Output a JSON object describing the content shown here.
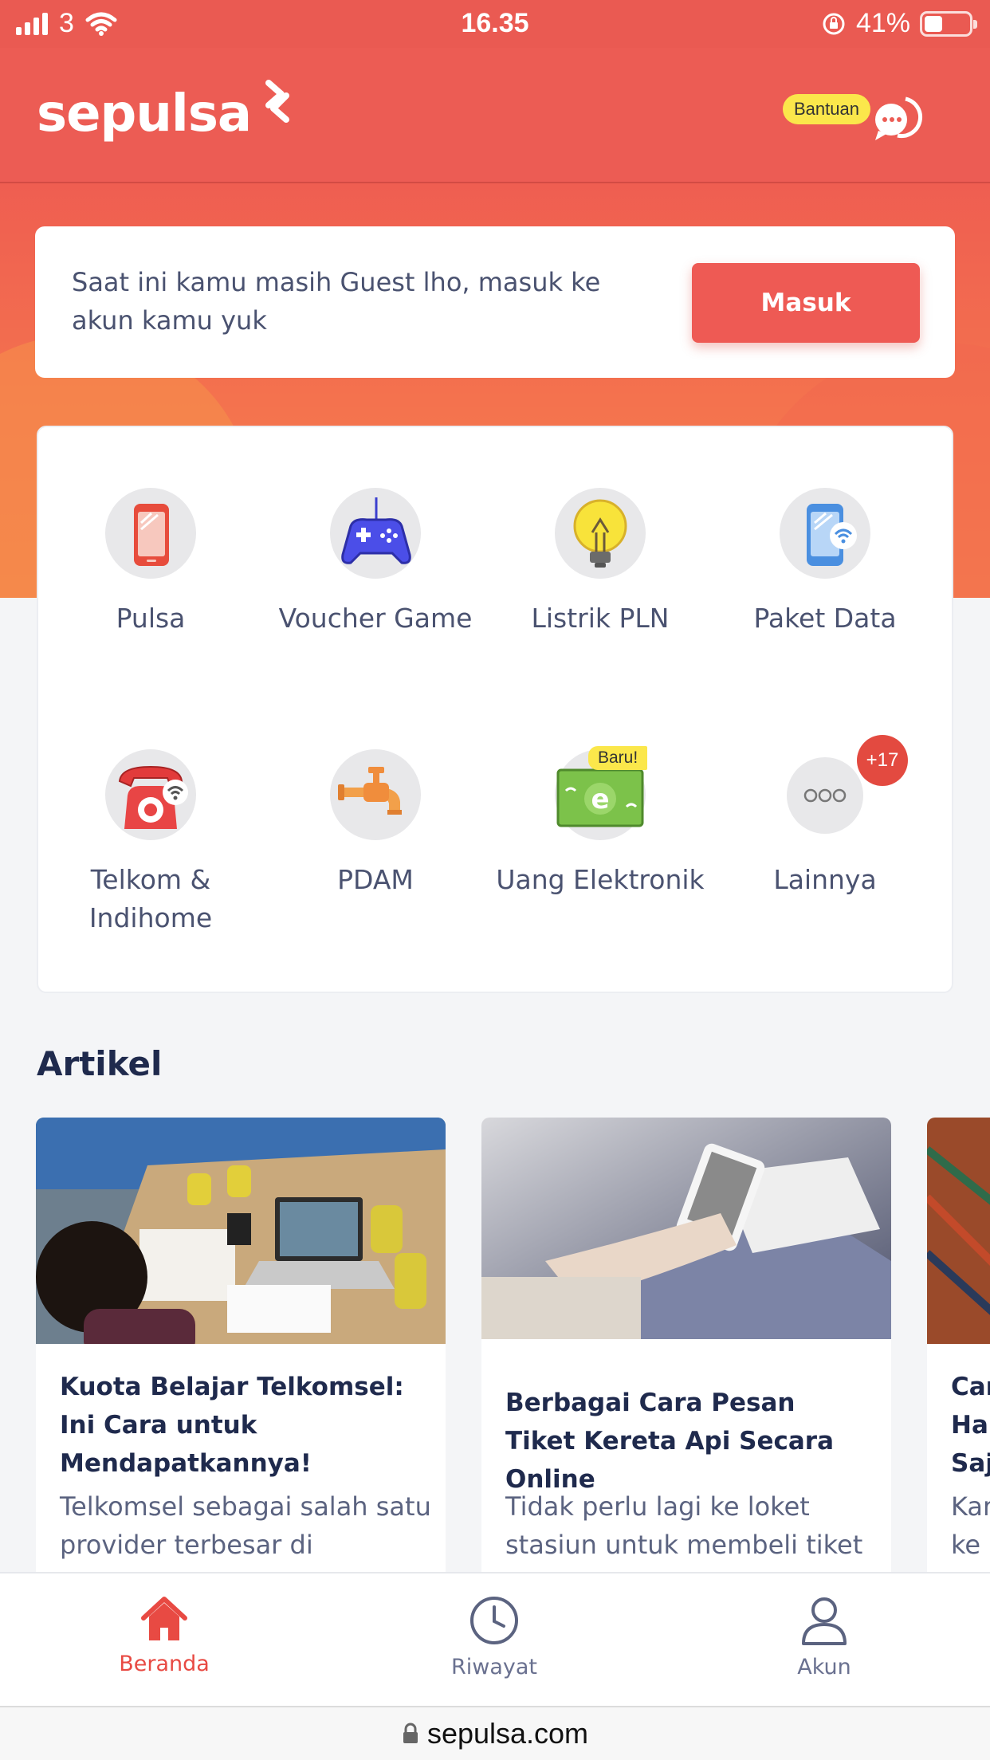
{
  "status_bar": {
    "carrier": "3",
    "time": "16.35",
    "battery_percent": "41%",
    "battery_level": 0.41
  },
  "header": {
    "logo_text": "sepulsa",
    "help_label": "Bantuan"
  },
  "guest_card": {
    "message": "Saat ini kamu masih Guest lho, masuk ke akun kamu yuk",
    "login_button": "Masuk"
  },
  "menu": [
    {
      "label": "Pulsa",
      "icon": "phone-icon"
    },
    {
      "label": "Voucher Game",
      "icon": "gamepad-icon"
    },
    {
      "label": "Listrik PLN",
      "icon": "lightbulb-icon"
    },
    {
      "label": "Paket Data",
      "icon": "phone-wifi-icon"
    },
    {
      "label": "Telkom & Indihome",
      "icon": "telephone-icon"
    },
    {
      "label": "PDAM",
      "icon": "water-tap-icon"
    },
    {
      "label": "Uang Elektronik",
      "icon": "e-money-icon",
      "badge": "Baru!"
    },
    {
      "label": "Lainnya",
      "icon": "more-icon",
      "badge": "+17"
    }
  ],
  "articles_section": {
    "title": "Artikel",
    "items": [
      {
        "title": "Kuota Belajar Telkomsel: Ini Cara untuk Mendapatkannya!",
        "description": "Telkomsel sebagai salah satu provider terbesar di Indonesia"
      },
      {
        "title": "Berbagai Cara Pesan Tiket Kereta Api Secara Online",
        "description": "Tidak perlu lagi ke loket stasiun untuk membeli tiket"
      },
      {
        "title": "Car Har Saj",
        "description": "Kar ke l"
      }
    ]
  },
  "bottom_nav": [
    {
      "label": "Beranda",
      "icon": "home-icon",
      "active": true
    },
    {
      "label": "Riwayat",
      "icon": "clock-icon",
      "active": false
    },
    {
      "label": "Akun",
      "icon": "user-icon",
      "active": false
    }
  ],
  "browser": {
    "url": "sepulsa.com"
  },
  "colors": {
    "brand": "#ec5c54",
    "accent_yellow": "#fbe74b",
    "title_navy": "#1f2a4d"
  }
}
